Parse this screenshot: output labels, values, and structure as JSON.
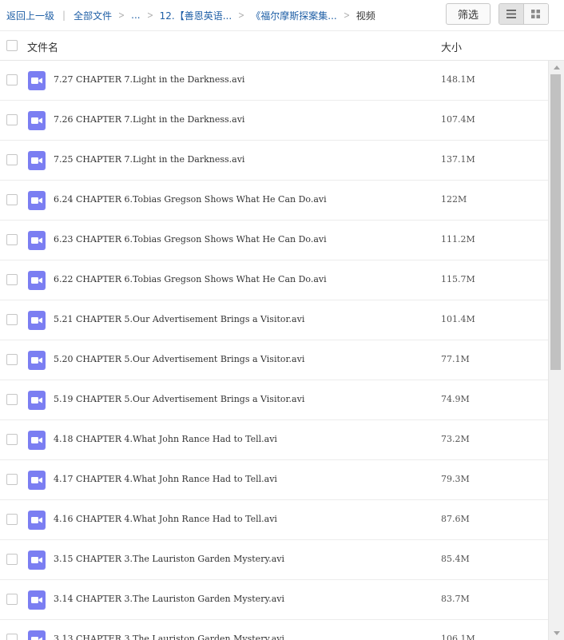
{
  "breadcrumb": {
    "back_label": "返回上一级",
    "root_label": "全部文件",
    "ellipsis": "...",
    "folder1": "12.【善恩英语...",
    "folder2": "《福尔摩斯探案集...",
    "current": "视频"
  },
  "toolbar": {
    "filter_label": "筛选",
    "view_mode": "list",
    "icons": [
      "list-view-icon",
      "grid-view-icon"
    ]
  },
  "table": {
    "headers": {
      "name": "文件名",
      "size": "大小"
    },
    "rows": [
      {
        "name": "7.27 CHAPTER 7.Light in the Darkness.avi",
        "size": "148.1M"
      },
      {
        "name": "7.26 CHAPTER 7.Light in the Darkness.avi",
        "size": "107.4M"
      },
      {
        "name": "7.25 CHAPTER 7.Light in the Darkness.avi",
        "size": "137.1M"
      },
      {
        "name": "6.24 CHAPTER 6.Tobias Gregson Shows What He Can Do.avi",
        "size": "122M"
      },
      {
        "name": "6.23 CHAPTER 6.Tobias Gregson Shows What He Can Do.avi",
        "size": "111.2M"
      },
      {
        "name": "6.22 CHAPTER 6.Tobias Gregson Shows What He Can Do.avi",
        "size": "115.7M"
      },
      {
        "name": "5.21 CHAPTER 5.Our Advertisement Brings a Visitor.avi",
        "size": "101.4M"
      },
      {
        "name": "5.20 CHAPTER 5.Our Advertisement Brings a Visitor.avi",
        "size": "77.1M"
      },
      {
        "name": "5.19 CHAPTER 5.Our Advertisement Brings a Visitor.avi",
        "size": "74.9M"
      },
      {
        "name": "4.18 CHAPTER 4.What John Rance Had to Tell.avi",
        "size": "73.2M"
      },
      {
        "name": "4.17 CHAPTER 4.What John Rance Had to Tell.avi",
        "size": "79.3M"
      },
      {
        "name": "4.16 CHAPTER 4.What John Rance Had to Tell.avi",
        "size": "87.6M"
      },
      {
        "name": "3.15 CHAPTER 3.The Lauriston Garden Mystery.avi",
        "size": "85.4M"
      },
      {
        "name": "3.14 CHAPTER 3.The Lauriston Garden Mystery.avi",
        "size": "83.7M"
      },
      {
        "name": "3.13 CHAPTER 3.The Lauriston Garden Mystery.avi",
        "size": "106.1M"
      }
    ]
  },
  "file_icon": "video-file-icon",
  "colors": {
    "link": "#1f5fa6",
    "video_icon": "#7b7ef2",
    "row_border": "#ececec"
  }
}
